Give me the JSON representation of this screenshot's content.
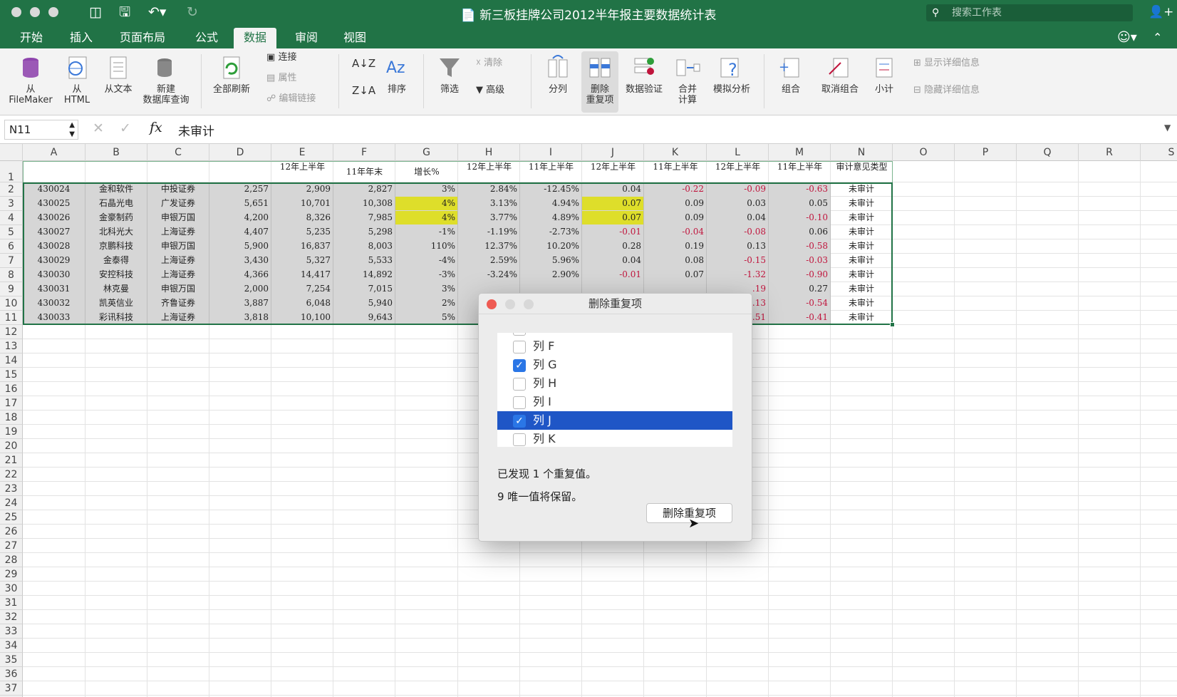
{
  "window": {
    "title": "新三板挂牌公司2012半年报主要数据统计表",
    "search_placeholder": "搜索工作表"
  },
  "tabs": [
    {
      "label": "开始",
      "active": false
    },
    {
      "label": "插入",
      "active": false
    },
    {
      "label": "页面布局",
      "active": false
    },
    {
      "label": "公式",
      "active": false
    },
    {
      "label": "数据",
      "active": true
    },
    {
      "label": "审阅",
      "active": false
    },
    {
      "label": "视图",
      "active": false
    }
  ],
  "ribbon": {
    "from_filemaker": "从\nFileMaker",
    "from_html": "从\nHTML",
    "from_text": "从文本",
    "new_db_query": "新建\n数据库查询",
    "refresh_all": "全部刷新",
    "connections": "连接",
    "properties": "属性",
    "edit_links": "编辑链接",
    "sort": "排序",
    "filter": "筛选",
    "clear": "清除",
    "advanced": "高级",
    "text_to_columns": "分列",
    "remove_duplicates": "删除\n重复项",
    "data_validation": "数据验证",
    "consolidate": "合并\n计算",
    "what_if": "模拟分析",
    "group": "组合",
    "ungroup": "取消组合",
    "subtotal": "小计",
    "show_detail": "显示详细信息",
    "hide_detail": "隐藏详细信息"
  },
  "formula_bar": {
    "name_box": "N11",
    "fx": "fx",
    "value": "未审计"
  },
  "columns": [
    "A",
    "B",
    "C",
    "D",
    "E",
    "F",
    "G",
    "H",
    "I",
    "J",
    "K",
    "L",
    "M",
    "N",
    "O",
    "P",
    "Q",
    "R",
    "S"
  ],
  "header_row": [
    "",
    "",
    "",
    "",
    "12年上半年",
    "11年年末",
    "增长%",
    "12年上半年",
    "11年上半年",
    "12年上半年",
    "11年上半年",
    "12年上半年",
    "11年上半年",
    "审计意见类型"
  ],
  "rows": [
    [
      "430024",
      "金和软件",
      "中投证券",
      "2,257",
      "2,909",
      "2,827",
      "3%",
      "2.84%",
      "-12.45%",
      "0.04",
      "-0.22",
      "-0.09",
      "-0.63",
      "未审计"
    ],
    [
      "430025",
      "石晶光电",
      "广发证券",
      "5,651",
      "10,701",
      "10,308",
      "4%",
      "3.13%",
      "4.94%",
      "0.07",
      "0.09",
      "0.03",
      "0.05",
      "未审计"
    ],
    [
      "430026",
      "金豪制药",
      "申银万国",
      "4,200",
      "8,326",
      "7,985",
      "4%",
      "3.77%",
      "4.89%",
      "0.07",
      "0.09",
      "0.04",
      "-0.10",
      "未审计"
    ],
    [
      "430027",
      "北科光大",
      "上海证券",
      "4,407",
      "5,235",
      "5,298",
      "-1%",
      "-1.19%",
      "-2.73%",
      "-0.01",
      "-0.04",
      "-0.08",
      "0.06",
      "未审计"
    ],
    [
      "430028",
      "京鹏科技",
      "申银万国",
      "5,900",
      "16,837",
      "8,003",
      "110%",
      "12.37%",
      "10.20%",
      "0.28",
      "0.19",
      "0.13",
      "-0.58",
      "未审计"
    ],
    [
      "430029",
      "金泰得",
      "上海证券",
      "3,430",
      "5,327",
      "5,533",
      "-4%",
      "2.59%",
      "5.96%",
      "0.04",
      "0.08",
      "-0.15",
      "-0.03",
      "未审计"
    ],
    [
      "430030",
      "安控科技",
      "上海证券",
      "4,366",
      "14,417",
      "14,892",
      "-3%",
      "-3.24%",
      "2.90%",
      "-0.01",
      "0.07",
      "-1.32",
      "-0.90",
      "未审计"
    ],
    [
      "430031",
      "林克曼",
      "申银万国",
      "2,000",
      "7,254",
      "7,015",
      "3%",
      "",
      "",
      "",
      "",
      ".19",
      "0.27",
      "未审计"
    ],
    [
      "430032",
      "凯英信业",
      "齐鲁证券",
      "3,887",
      "6,048",
      "5,940",
      "2%",
      "",
      "",
      "",
      "",
      ".13",
      "-0.54",
      "未审计"
    ],
    [
      "430033",
      "彩讯科技",
      "上海证券",
      "3,818",
      "10,100",
      "9,643",
      "5%",
      "",
      "",
      "",
      "",
      ".51",
      "-0.41",
      "未审计"
    ]
  ],
  "dialog": {
    "title": "删除重复项",
    "items": [
      {
        "label": "列 F",
        "checked": false,
        "selected": false
      },
      {
        "label": "列 G",
        "checked": true,
        "selected": false
      },
      {
        "label": "列 H",
        "checked": false,
        "selected": false
      },
      {
        "label": "列 I",
        "checked": false,
        "selected": false
      },
      {
        "label": "列 J",
        "checked": true,
        "selected": true
      },
      {
        "label": "列 K",
        "checked": false,
        "selected": false
      }
    ],
    "found_msg": "已发现 1 个重复值。",
    "unique_msg": "9 唯一值将保留。",
    "button": "删除重复项"
  },
  "colors": {
    "excel_green": "#217346",
    "highlight_yellow": "#dede2a",
    "selection_blue": "#1f56c6",
    "negative_red": "#c0143c",
    "data_fill": "#d6d6d6"
  }
}
